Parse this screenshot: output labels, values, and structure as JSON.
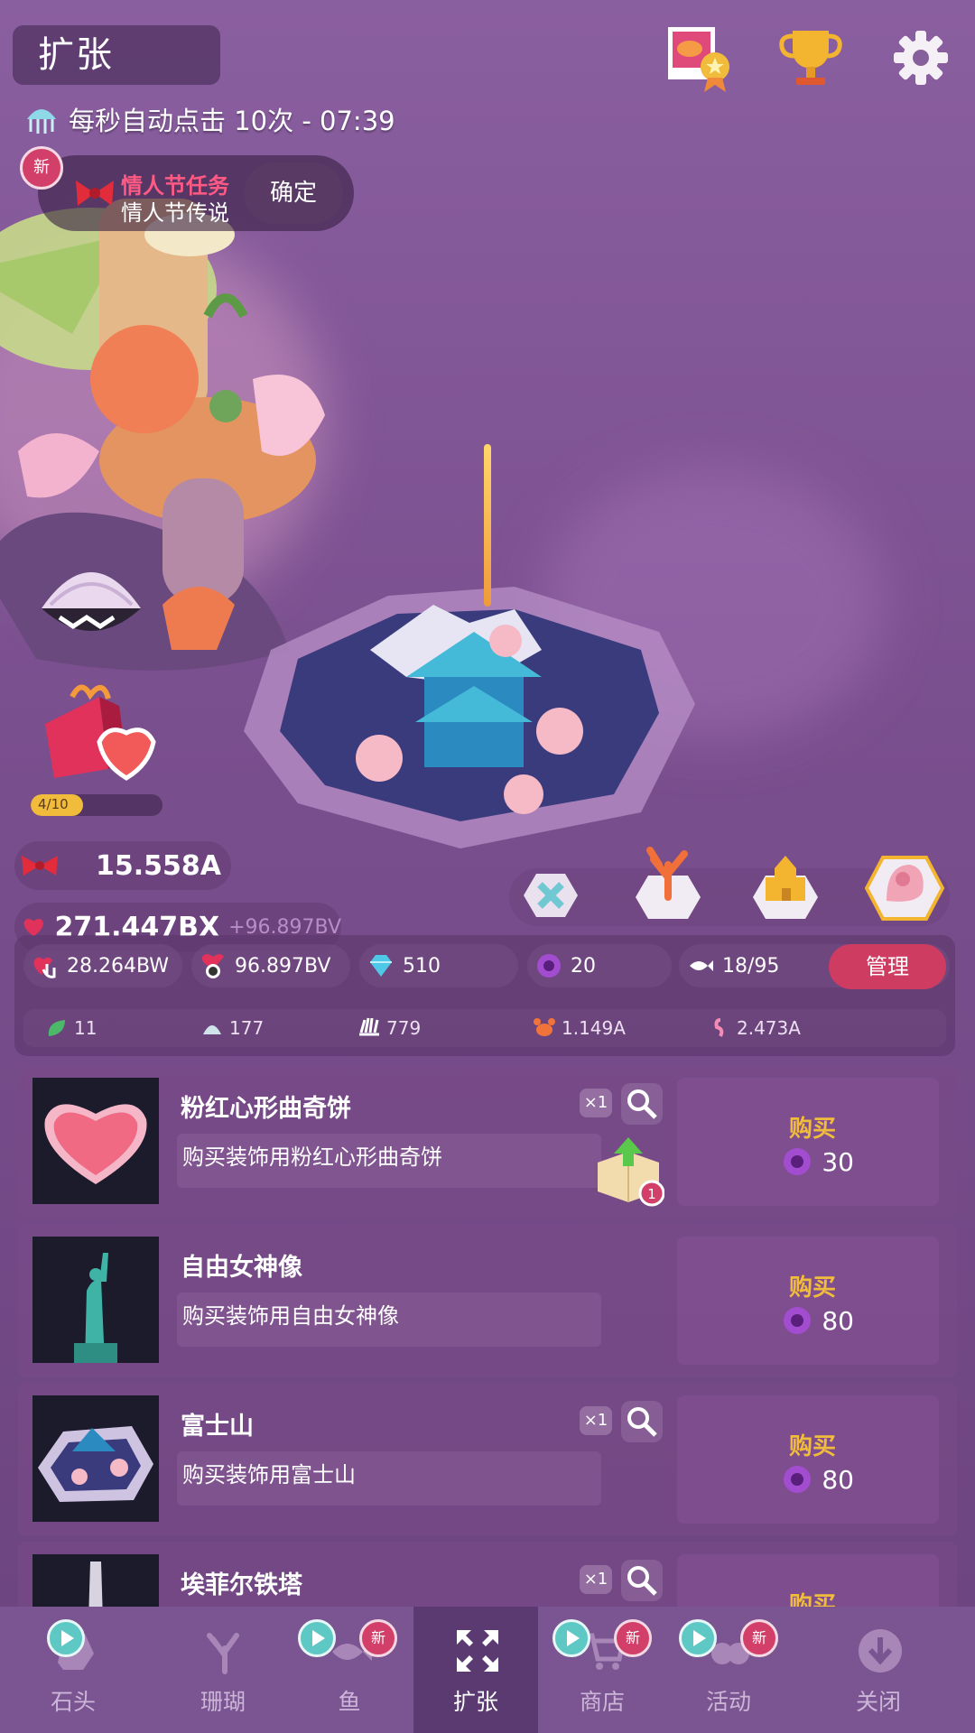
{
  "header": {
    "title": "扩张",
    "auto_click": "每秒自动点击 10次 - 07:39"
  },
  "quest": {
    "badge": "新",
    "title": "情人节任务",
    "subtitle": "情人节传说",
    "confirm": "确定"
  },
  "gift": {
    "progress_text": "4/10",
    "progress": 0.4
  },
  "currency": {
    "main": "15.558A",
    "hearts": "271.447BX",
    "hearts_rate": "+96.897BV"
  },
  "stats": {
    "heart_per_tap": "28.264BW",
    "heart_per_sec": "96.897BV",
    "gems": "510",
    "pearls": "20",
    "fish": "18/95",
    "manage": "管理",
    "leaf": "11",
    "shell": "177",
    "urchin": "779",
    "crab": "1.149A",
    "flamingo": "2.473A"
  },
  "shop_items": [
    {
      "name": "粉红心形曲奇饼",
      "desc": "购买装饰用粉红心形曲奇饼",
      "count": "×1",
      "buy": "购买",
      "price": "30",
      "box_badge": "1"
    },
    {
      "name": "自由女神像",
      "desc": "购买装饰用自由女神像",
      "buy": "购买",
      "price": "80"
    },
    {
      "name": "富士山",
      "desc": "购买装饰用富士山",
      "count": "×1",
      "buy": "购买",
      "price": "80"
    },
    {
      "name": "埃菲尔铁塔",
      "count": "×1",
      "buy": "购买"
    }
  ],
  "nav": {
    "stone": "石头",
    "coral": "珊瑚",
    "fish": "鱼",
    "expand": "扩张",
    "shop": "商店",
    "events": "活动",
    "close": "关闭",
    "new": "新"
  },
  "colors": {
    "accent_pink": "#d2406a",
    "gold": "#f1bb3c",
    "teal": "#5ec8c4"
  }
}
